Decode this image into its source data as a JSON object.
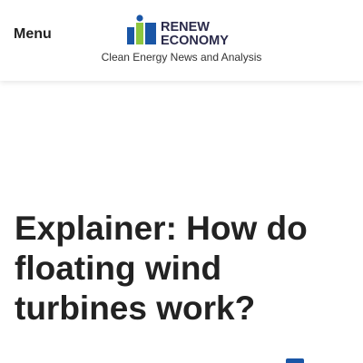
{
  "header": {
    "menu_label": "Menu",
    "logo_line1": "RENEW",
    "logo_line2": "ECONOMY",
    "tagline": "Clean Energy News and Analysis"
  },
  "article": {
    "title": "Explainer: How do floating wind turbines work?"
  },
  "colors": {
    "logo_blue": "#1a56a6",
    "logo_green": "#8dc63f",
    "text_dark": "#222222"
  },
  "icons": {
    "logo": "renew-economy-logo-icon",
    "share": "share-icon"
  }
}
